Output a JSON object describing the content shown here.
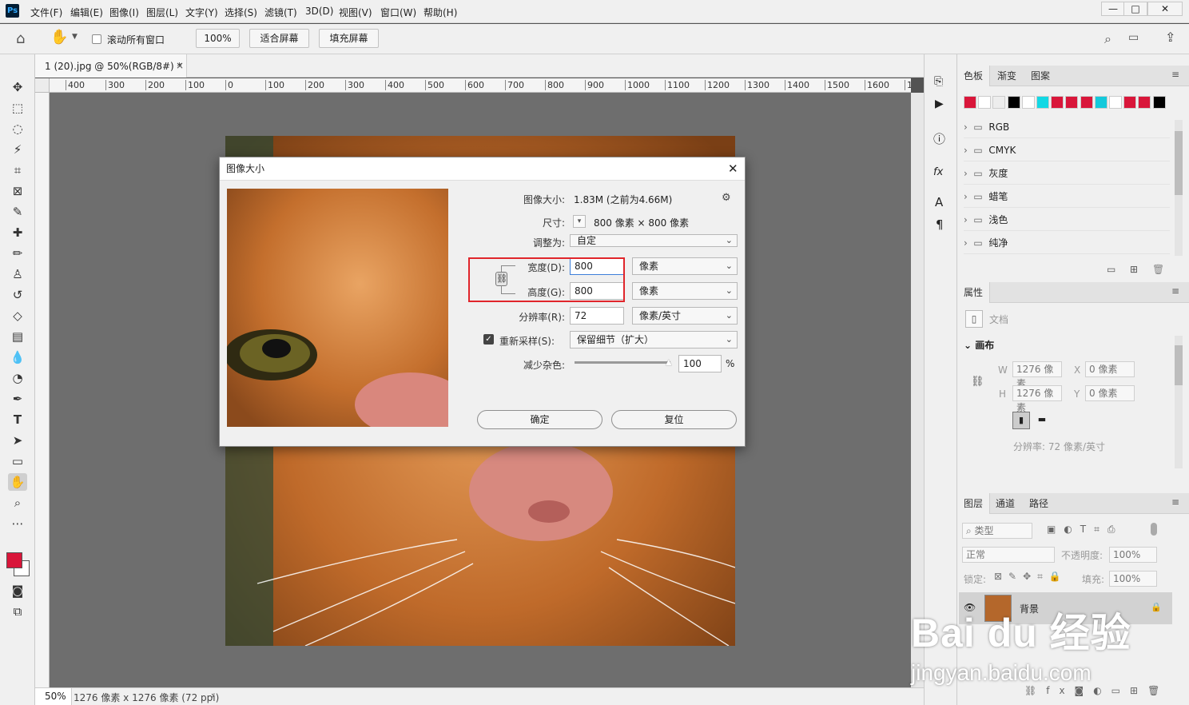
{
  "app": {
    "logo": "Ps"
  },
  "menus": [
    "文件(F)",
    "编辑(E)",
    "图像(I)",
    "图层(L)",
    "文字(Y)",
    "选择(S)",
    "滤镜(T)",
    "3D(D)",
    "视图(V)",
    "窗口(W)",
    "帮助(H)"
  ],
  "window_controls": {
    "minimize": "—",
    "maximize": "□",
    "close": "✕"
  },
  "options": {
    "scroll_all_label": "滚动所有窗口",
    "zoom_btn": "100%",
    "fit_btn": "适合屏幕",
    "fill_btn": "填充屏幕"
  },
  "document": {
    "tab_title": "1 (20).jpg @ 50%(RGB/8#) *",
    "tab_close": "×"
  },
  "ruler_h": [
    "400",
    "300",
    "200",
    "100",
    "0",
    "100",
    "200",
    "300",
    "400",
    "500",
    "600",
    "700",
    "800",
    "900",
    "1000",
    "1100",
    "1200",
    "1300",
    "1400",
    "1500",
    "1600",
    "1"
  ],
  "status": {
    "zoom": "50%",
    "info": "1276 像素 x 1276 像素 (72 ppi)",
    "arrow": "›"
  },
  "dialog": {
    "title": "图像大小",
    "close": "✕",
    "image_size_label": "图像大小:",
    "image_size_value": "1.83M (之前为4.66M)",
    "dimensions_label": "尺寸:",
    "dimensions_value": "800 像素 × 800 像素",
    "fit_to_label": "调整为:",
    "fit_to_value": "自定",
    "width_label": "宽度(D):",
    "width_value": "800",
    "width_unit": "像素",
    "height_label": "高度(G):",
    "height_value": "800",
    "height_unit": "像素",
    "resolution_label": "分辨率(R):",
    "resolution_value": "72",
    "resolution_unit": "像素/英寸",
    "resample_label": "重新采样(S):",
    "resample_value": "保留细节（扩大）",
    "reduce_noise_label": "减少杂色:",
    "reduce_noise_value": "100",
    "reduce_noise_unit": "%",
    "reduce_noise_level": 1.0,
    "ok": "确定",
    "reset": "复位"
  },
  "swatches_panel": {
    "tabs": [
      "色板",
      "渐变",
      "图案"
    ],
    "colors": [
      "#d9163a",
      "#ffffff",
      "#ededed",
      "#000000",
      "#ffffff",
      "#12d8e4",
      "#d9163a",
      "#d9163a",
      "#d9163a",
      "#14c9db",
      "#ffffff",
      "#d9163a",
      "#d9163a",
      "#000000"
    ],
    "groups": [
      "RGB",
      "CMYK",
      "灰度",
      "蜡笔",
      "浅色",
      "纯净"
    ]
  },
  "properties_panel": {
    "tab": "属性",
    "doc_label": "文档",
    "canvas_label": "画布",
    "w_label": "W",
    "w_value": "1276 像素",
    "h_label": "H",
    "h_value": "1276 像素",
    "x_label": "X",
    "x_value": "0 像素",
    "y_label": "Y",
    "y_value": "0 像素",
    "resolution": "分辨率: 72 像素/英寸"
  },
  "layers_panel": {
    "tabs": [
      "图层",
      "通道",
      "路径"
    ],
    "filter_label": "类型",
    "blend_mode": "正常",
    "opacity_label": "不透明度:",
    "opacity_value": "100%",
    "lock_label": "锁定:",
    "fill_label": "填充:",
    "fill_value": "100%",
    "layer_name": "背景"
  },
  "watermark": {
    "brand": "Bai du 经验",
    "url": "jingyan.baidu.com"
  },
  "colors": {
    "foreground": "#d9163a",
    "background": "#ffffff",
    "highlight": "#e0252b"
  }
}
